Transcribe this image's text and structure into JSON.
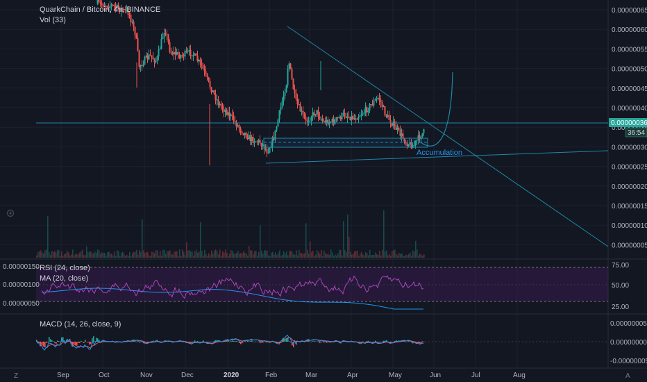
{
  "header": {
    "symbol_title": "QuarkChain / Bitcoin, 4h, BINANCE",
    "volume_label": "Vol (33)"
  },
  "price_axis": {
    "ticks": [
      "0.00000065",
      "0.00000060",
      "0.00000055",
      "0.00000050",
      "0.00000045",
      "0.00000040",
      "0.00000035",
      "0.00000030",
      "0.00000025",
      "0.00000020",
      "0.00000015",
      "0.00000010",
      "0.00000005"
    ],
    "current_price": "0.00000036",
    "countdown": "36:54"
  },
  "rsi_pane": {
    "left_ticks": [
      "0.00000150",
      "0.00000100",
      "0.00000050"
    ],
    "right_ticks": [
      "75.00",
      "50.00",
      "25.00"
    ],
    "rsi_label": "RSI (24, close)",
    "ma_label": "MA (20, close)"
  },
  "macd_pane": {
    "label": "MACD (14, 26, close, 9)",
    "right_ticks": [
      "0.00000005",
      "0.00000000",
      "-0.00000005"
    ]
  },
  "time_axis": {
    "labels": [
      "Sep",
      "Oct",
      "Nov",
      "Dec",
      "2020",
      "Feb",
      "Mar",
      "Apr",
      "May",
      "Jun",
      "Jul",
      "Aug"
    ]
  },
  "annotations": {
    "accumulation": "Accumulation"
  },
  "icons": {
    "settings": "gear-icon",
    "timezone": "Z",
    "scale_mode": "A"
  },
  "colors": {
    "background": "#131722",
    "up": "#26a69a",
    "down": "#ef5350",
    "drawing": "#2196f3",
    "rsi": "#ab47bc",
    "current_price_bg": "#26a69a"
  }
}
